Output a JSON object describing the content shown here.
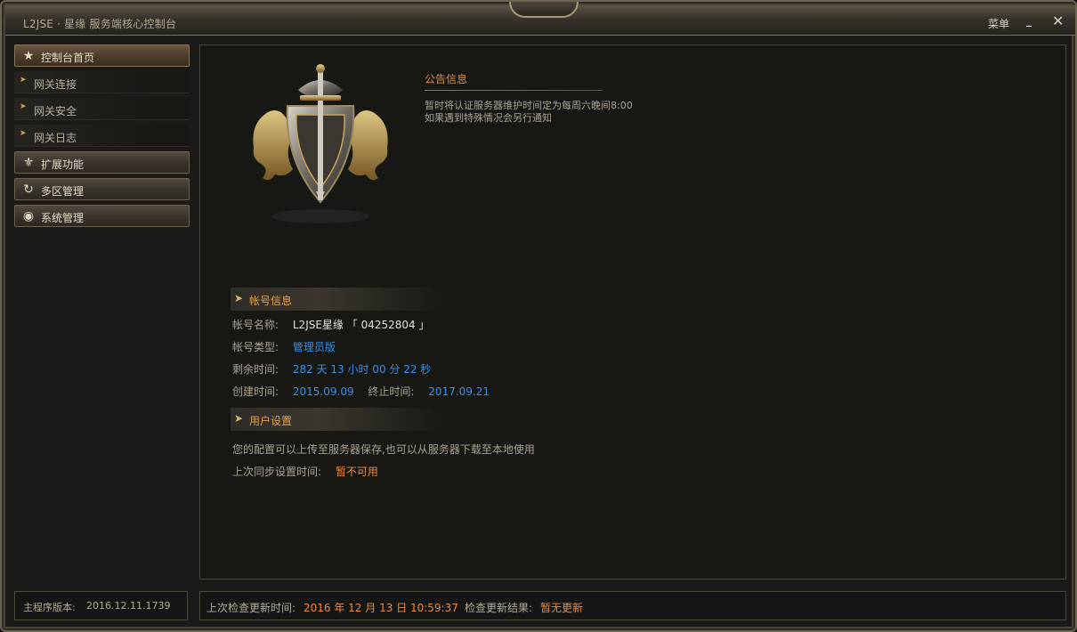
{
  "window": {
    "title": "L2JSE · 星缘  服务端核心控制台",
    "menu_label": "菜单",
    "minimize_glyph": "_",
    "close_glyph": "✕"
  },
  "sidebar": {
    "items": [
      {
        "label": "控制台首页",
        "icon": "star-icon",
        "kind": "main",
        "active": true
      },
      {
        "label": "网关连接",
        "icon": "pointer-icon",
        "kind": "sub"
      },
      {
        "label": "网关安全",
        "icon": "pointer-icon",
        "kind": "sub"
      },
      {
        "label": "网关日志",
        "icon": "pointer-icon",
        "kind": "sub"
      },
      {
        "label": "扩展功能",
        "icon": "fleur-de-lis-icon",
        "kind": "main"
      },
      {
        "label": "多区管理",
        "icon": "refresh-icon",
        "kind": "main"
      },
      {
        "label": "系统管理",
        "icon": "eye-icon",
        "kind": "main"
      }
    ]
  },
  "version": {
    "label": "主程序版本:",
    "value": "2016.12.11.1739"
  },
  "notice": {
    "title": "公告信息",
    "line1": "暂时将认证服务器维护时间定为每周六晚间8:00",
    "line2": "如果遇到特殊情况会另行通知"
  },
  "account": {
    "section_title": "帐号信息",
    "name_label": "帐号名称:",
    "name_value": "L2JSE星缘",
    "id_value": "「 04252804 」",
    "type_label": "帐号类型:",
    "type_value": "管理员版",
    "remaining_label": "剩余时间:",
    "remaining_value": "282 天 13 小时 00 分 22 秒",
    "created_label": "创建时间:",
    "created_value": "2015.09.09",
    "end_label": "终止时间:",
    "end_value": "2017.09.21"
  },
  "user_settings": {
    "section_title": "用户设置",
    "description": "您的配置可以上传至服务器保存,也可以从服务器下载至本地使用",
    "last_sync_label": "上次同步设置时间:",
    "last_sync_value": "暂不可用"
  },
  "status": {
    "check_label": "上次检查更新时间:",
    "check_value": "2016 年 12 月 13 日 10:59:37",
    "result_label": "检查更新结果:",
    "result_value": "暂无更新"
  },
  "colors": {
    "accent_orange": "#ef8a3a",
    "accent_blue": "#3c8ee6",
    "frame": "#6d6450"
  }
}
